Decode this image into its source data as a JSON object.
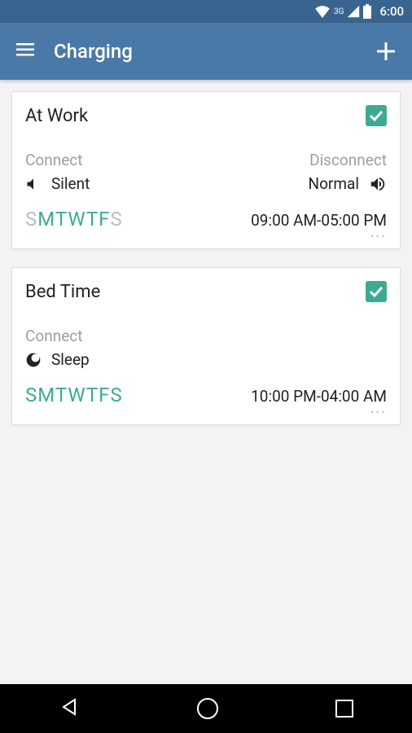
{
  "status": {
    "network": "3G",
    "time": "6:00"
  },
  "toolbar": {
    "title": "Charging"
  },
  "cards": [
    {
      "title": "At Work",
      "checked": true,
      "connect_label": "Connect",
      "disconnect_label": "Disconnect",
      "connect_action": "Silent",
      "disconnect_action": "Normal",
      "days": [
        {
          "letter": "S",
          "active": false
        },
        {
          "letter": "M",
          "active": true
        },
        {
          "letter": "T",
          "active": true
        },
        {
          "letter": "W",
          "active": true
        },
        {
          "letter": "T",
          "active": true
        },
        {
          "letter": "F",
          "active": true
        },
        {
          "letter": "S",
          "active": false
        }
      ],
      "time_range": "09:00 AM-05:00 PM",
      "has_disconnect": true
    },
    {
      "title": "Bed Time",
      "checked": true,
      "connect_label": "Connect",
      "connect_action": "Sleep",
      "days": [
        {
          "letter": "S",
          "active": true
        },
        {
          "letter": "M",
          "active": true
        },
        {
          "letter": "T",
          "active": true
        },
        {
          "letter": "W",
          "active": true
        },
        {
          "letter": "T",
          "active": true
        },
        {
          "letter": "F",
          "active": true
        },
        {
          "letter": "S",
          "active": true
        }
      ],
      "time_range": "10:00 PM-04:00 AM",
      "has_disconnect": false
    }
  ]
}
